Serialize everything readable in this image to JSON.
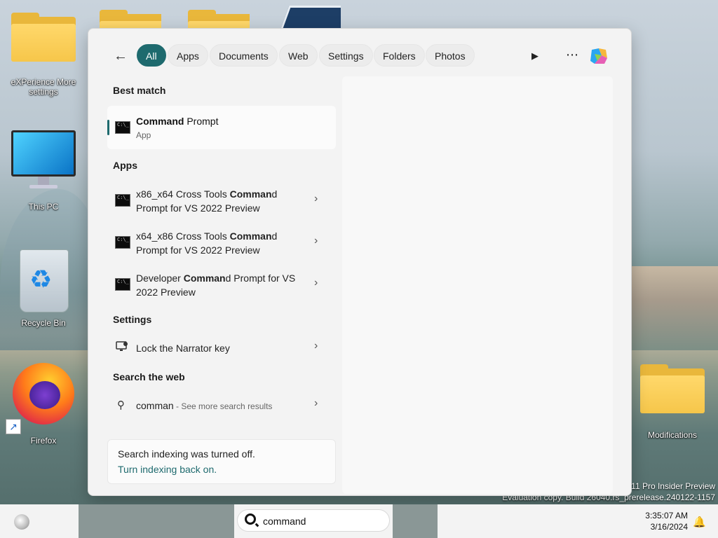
{
  "desktop": {
    "icons": [
      {
        "label": "eXPerience More settings"
      },
      {
        "label": "This PC"
      },
      {
        "label": "Recycle Bin"
      },
      {
        "label": "Firefox"
      },
      {
        "label": "Modifications"
      }
    ],
    "watermark_line1": "11 Pro Insider Preview",
    "watermark_line2": "Evaluation copy. Build 26040.rs_prerelease.240122-1157"
  },
  "search_panel": {
    "tabs": [
      "All",
      "Apps",
      "Documents",
      "Web",
      "Settings",
      "Folders",
      "Photos"
    ],
    "active_tab": "All",
    "best_match": {
      "section": "Best match",
      "name_bold": "Command",
      "name_rest": " Prompt",
      "type": "App"
    },
    "apps": {
      "section": "Apps",
      "items": [
        {
          "pre": "x86_x64 Cross Tools ",
          "bold": "Comman",
          "post": "d Prompt for VS 2022 Preview"
        },
        {
          "pre": "x64_x86 Cross Tools ",
          "bold": "Comman",
          "post": "d Prompt for VS 2022 Preview"
        },
        {
          "pre": "Developer ",
          "bold": "Comman",
          "post": "d Prompt for VS 2022 Preview"
        }
      ]
    },
    "settings": {
      "section": "Settings",
      "items": [
        {
          "label": "Lock the Narrator key"
        }
      ]
    },
    "web": {
      "section": "Search the web",
      "query": "comman",
      "hint": " - See more search results"
    },
    "indexing": {
      "message": "Search indexing was turned off.",
      "link": "Turn indexing back on."
    }
  },
  "taskbar": {
    "search_value": "command",
    "time": "3:35:07 AM",
    "date": "3/16/2024"
  },
  "colors": {
    "accent": "#1e6a6e"
  },
  "icons": [
    "back-arrow-icon",
    "play-icon",
    "more-icon",
    "copilot-icon",
    "command-prompt-icon",
    "narrator-icon",
    "search-icon",
    "chevron-right-icon",
    "bell-icon",
    "widgets-icon"
  ]
}
